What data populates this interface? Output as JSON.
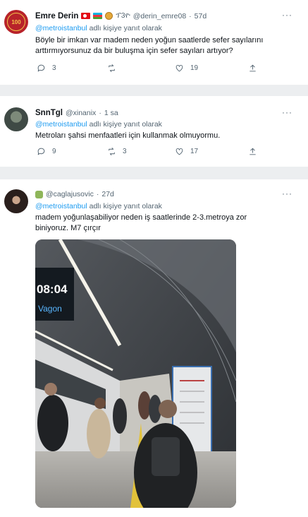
{
  "tweets": [
    {
      "display_name": "Emre Derin",
      "extra_name": "ፕ3ዮ",
      "handle": "@derin_emre08",
      "time": "57d",
      "reply_mention": "@metroistanbul",
      "reply_text": " adlı kişiye yanıt olarak",
      "text": "Böyle bir imkan var madem neden yoğun saatlerde sefer sayılarını arttırmıyorsunuz da bir buluşma için sefer sayıları artıyor?",
      "avatar_text": "100",
      "stats": {
        "reply": "3",
        "retweet": "",
        "like": "19"
      }
    },
    {
      "display_name": "SnnTgl",
      "handle": "@xinanix",
      "time": "1 sa",
      "reply_mention": "@metroistanbul",
      "reply_text": " adlı kişiye yanıt olarak",
      "text": "Metroları şahsi menfaatleri için kullanmak olmuyormu.",
      "stats": {
        "reply": "9",
        "retweet": "3",
        "like": "17"
      }
    },
    {
      "handle": "@caglajusovic",
      "time": "27d",
      "reply_mention": "@metroistanbul",
      "reply_text": " adlı kişiye yanıt olarak",
      "text": "madem yoğunlaşabiliyor neden iş saatlerinde 2-3.metroya zor biniyoruz. M7 çırçır",
      "stats": {
        "reply": "",
        "retweet": "",
        "like": ""
      },
      "photo": {
        "display_time": "08:04",
        "display_label": "Vagon"
      }
    }
  ],
  "more_icon": "more-dots-icon",
  "colors": {
    "accent": "#1d9bf0",
    "muted": "#536471",
    "separator": "#eceef0"
  }
}
